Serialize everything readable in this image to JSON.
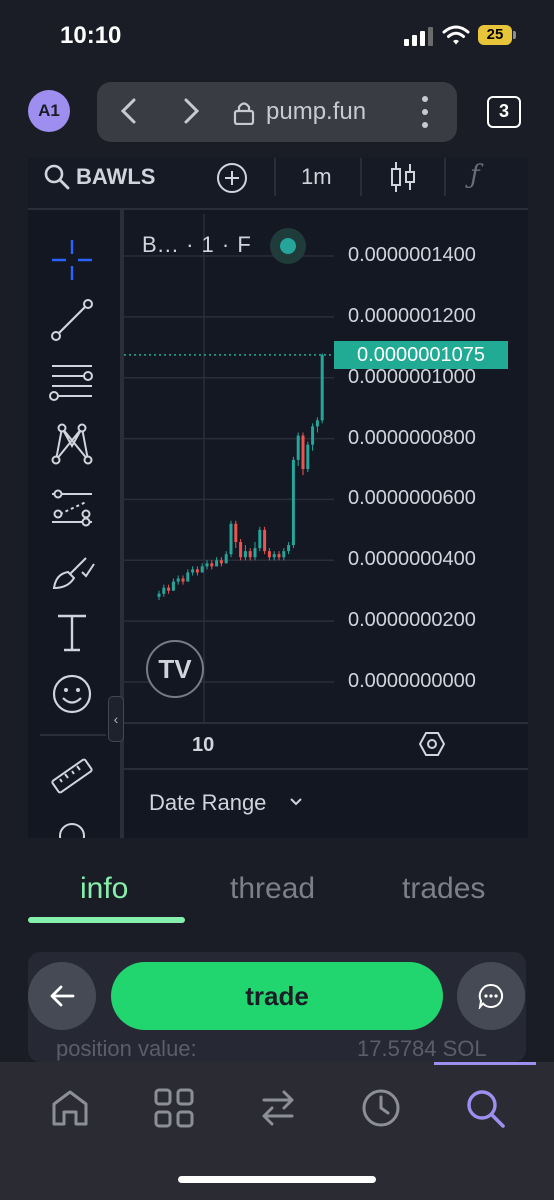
{
  "status_bar": {
    "time": "10:10",
    "battery": "25"
  },
  "browser": {
    "avatar": "A1",
    "url": "pump.fun",
    "tab_count": "3"
  },
  "chart_toolbar": {
    "symbol": "BAWLS",
    "interval": "1m"
  },
  "chart": {
    "legend": "B... · 1 · F",
    "y_axis_labels": [
      "0.0000001400",
      "0.0000001200",
      "0.0000001000",
      "0.0000000800",
      "0.0000000600",
      "0.0000000400",
      "0.0000000200",
      "0.0000000000"
    ],
    "last_price": "0.0000001075",
    "x_axis_label": "10",
    "logo": "TV",
    "date_range_label": "Date Range"
  },
  "chart_data": {
    "type": "candlestick",
    "ylim": [
      0,
      1.5e-07
    ],
    "y_ticks": [
      1.4e-07,
      1.2e-07,
      1e-07,
      8e-08,
      6e-08,
      4e-08,
      2e-08,
      0
    ],
    "x_ticks": [
      "10"
    ],
    "last_price": 1.075e-07,
    "candles": [
      {
        "o": 2.8,
        "c": 2.9,
        "h": 3.0,
        "l": 2.7
      },
      {
        "o": 2.9,
        "c": 3.1,
        "h": 3.2,
        "l": 2.8
      },
      {
        "o": 3.1,
        "c": 3.0,
        "h": 3.2,
        "l": 2.9
      },
      {
        "o": 3.0,
        "c": 3.3,
        "h": 3.4,
        "l": 3.0
      },
      {
        "o": 3.3,
        "c": 3.4,
        "h": 3.5,
        "l": 3.2
      },
      {
        "o": 3.4,
        "c": 3.3,
        "h": 3.5,
        "l": 3.2
      },
      {
        "o": 3.3,
        "c": 3.6,
        "h": 3.7,
        "l": 3.3
      },
      {
        "o": 3.6,
        "c": 3.7,
        "h": 3.8,
        "l": 3.5
      },
      {
        "o": 3.7,
        "c": 3.6,
        "h": 3.8,
        "l": 3.5
      },
      {
        "o": 3.6,
        "c": 3.8,
        "h": 3.9,
        "l": 3.6
      },
      {
        "o": 3.8,
        "c": 3.9,
        "h": 4.0,
        "l": 3.7
      },
      {
        "o": 3.9,
        "c": 3.8,
        "h": 4.0,
        "l": 3.7
      },
      {
        "o": 3.8,
        "c": 4.0,
        "h": 4.1,
        "l": 3.8
      },
      {
        "o": 4.0,
        "c": 3.9,
        "h": 4.1,
        "l": 3.8
      },
      {
        "o": 3.9,
        "c": 4.2,
        "h": 4.3,
        "l": 3.9
      },
      {
        "o": 4.2,
        "c": 5.2,
        "h": 5.3,
        "l": 4.1
      },
      {
        "o": 5.2,
        "c": 4.6,
        "h": 5.3,
        "l": 4.4
      },
      {
        "o": 4.6,
        "c": 4.1,
        "h": 4.7,
        "l": 4.0
      },
      {
        "o": 4.1,
        "c": 4.3,
        "h": 4.5,
        "l": 4.0
      },
      {
        "o": 4.3,
        "c": 4.1,
        "h": 4.4,
        "l": 4.0
      },
      {
        "o": 4.1,
        "c": 4.4,
        "h": 4.6,
        "l": 4.0
      },
      {
        "o": 4.4,
        "c": 5.0,
        "h": 5.1,
        "l": 4.3
      },
      {
        "o": 5.0,
        "c": 4.3,
        "h": 5.1,
        "l": 4.2
      },
      {
        "o": 4.3,
        "c": 4.1,
        "h": 4.4,
        "l": 4.0
      },
      {
        "o": 4.1,
        "c": 4.2,
        "h": 4.3,
        "l": 4.0
      },
      {
        "o": 4.2,
        "c": 4.1,
        "h": 4.3,
        "l": 4.0
      },
      {
        "o": 4.1,
        "c": 4.3,
        "h": 4.4,
        "l": 4.0
      },
      {
        "o": 4.3,
        "c": 4.5,
        "h": 4.6,
        "l": 4.2
      },
      {
        "o": 4.5,
        "c": 7.3,
        "h": 7.4,
        "l": 4.4
      },
      {
        "o": 7.3,
        "c": 8.1,
        "h": 8.2,
        "l": 7.1
      },
      {
        "o": 8.1,
        "c": 7.0,
        "h": 8.2,
        "l": 6.8
      },
      {
        "o": 7.0,
        "c": 7.8,
        "h": 7.9,
        "l": 6.9
      },
      {
        "o": 7.8,
        "c": 8.4,
        "h": 8.5,
        "l": 7.6
      },
      {
        "o": 8.4,
        "c": 8.6,
        "h": 8.7,
        "l": 8.2
      },
      {
        "o": 8.6,
        "c": 10.75,
        "h": 10.8,
        "l": 8.5
      }
    ]
  },
  "tabs": {
    "info": "info",
    "thread": "thread",
    "trades": "trades"
  },
  "info_card": {
    "label": "position value:",
    "value": "17.5784 SOL"
  },
  "actions": {
    "trade": "trade"
  },
  "colors": {
    "accent_green": "#22d66f",
    "tab_green": "#86efac",
    "candle_up": "#26a69a",
    "candle_down": "#ef5350",
    "nav_active": "#9d8ef0"
  }
}
